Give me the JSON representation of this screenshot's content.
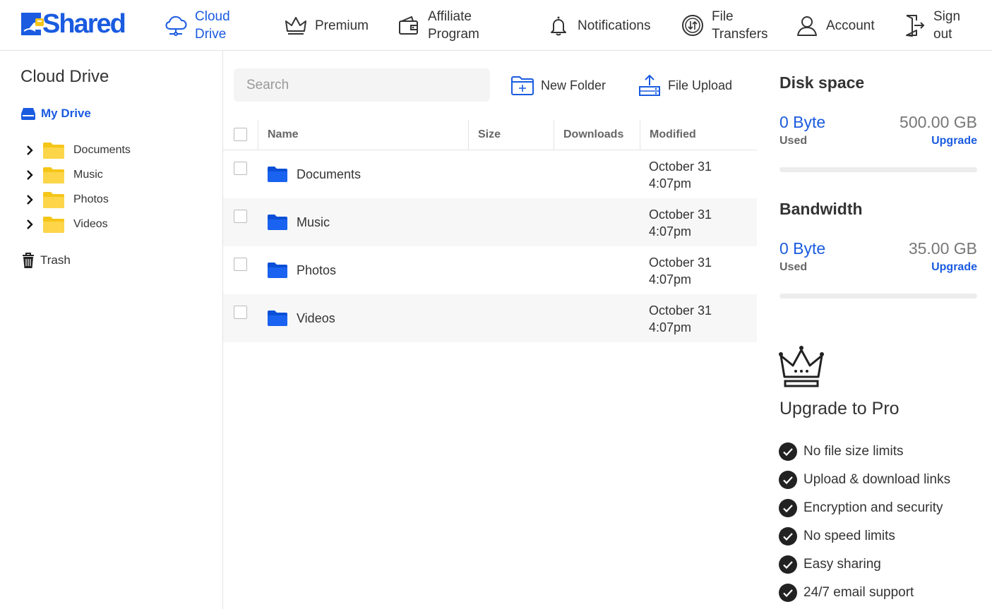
{
  "brand": {
    "logo_text": "Shared",
    "accent": "#1a5be0"
  },
  "nav": [
    {
      "label": "Cloud\nDrive",
      "icon": "cloud-icon",
      "active": true
    },
    {
      "label": "Premium",
      "icon": "crown-icon"
    },
    {
      "label": "Affiliate\nProgram",
      "icon": "wallet-icon"
    },
    {
      "label": "Notifications",
      "icon": "bell-icon"
    },
    {
      "label": "File\nTransfers",
      "icon": "transfer-icon"
    },
    {
      "label": "Account",
      "icon": "user-icon"
    },
    {
      "label": "Sign\nout",
      "icon": "sign-out-icon"
    }
  ],
  "sidebar": {
    "title": "Cloud Drive",
    "my_drive": "My Drive",
    "tree": [
      "Documents",
      "Music",
      "Photos",
      "Videos"
    ],
    "trash": "Trash"
  },
  "main": {
    "search_placeholder": "Search",
    "new_folder": "New Folder",
    "file_upload": "File Upload",
    "columns": {
      "name": "Name",
      "size": "Size",
      "downloads": "Downloads",
      "modified": "Modified"
    },
    "rows": [
      {
        "name": "Documents",
        "size": "",
        "downloads": "",
        "modified_date": "October 31",
        "modified_time": "4:07pm"
      },
      {
        "name": "Music",
        "size": "",
        "downloads": "",
        "modified_date": "October 31",
        "modified_time": "4:07pm"
      },
      {
        "name": "Photos",
        "size": "",
        "downloads": "",
        "modified_date": "October 31",
        "modified_time": "4:07pm"
      },
      {
        "name": "Videos",
        "size": "",
        "downloads": "",
        "modified_date": "October 31",
        "modified_time": "4:07pm"
      }
    ]
  },
  "right": {
    "disk": {
      "title": "Disk space",
      "used": "0 Byte",
      "total": "500.00 GB",
      "used_label": "Used",
      "upgrade": "Upgrade",
      "fraction": 0
    },
    "bandwidth": {
      "title": "Bandwidth",
      "used": "0 Byte",
      "total": "35.00 GB",
      "used_label": "Used",
      "upgrade": "Upgrade",
      "fraction": 0
    },
    "pro_title": "Upgrade to Pro",
    "features": [
      "No file size limits",
      "Upload & download links",
      "Encryption and security",
      "No speed limits",
      "Easy sharing",
      "24/7 email support"
    ]
  }
}
